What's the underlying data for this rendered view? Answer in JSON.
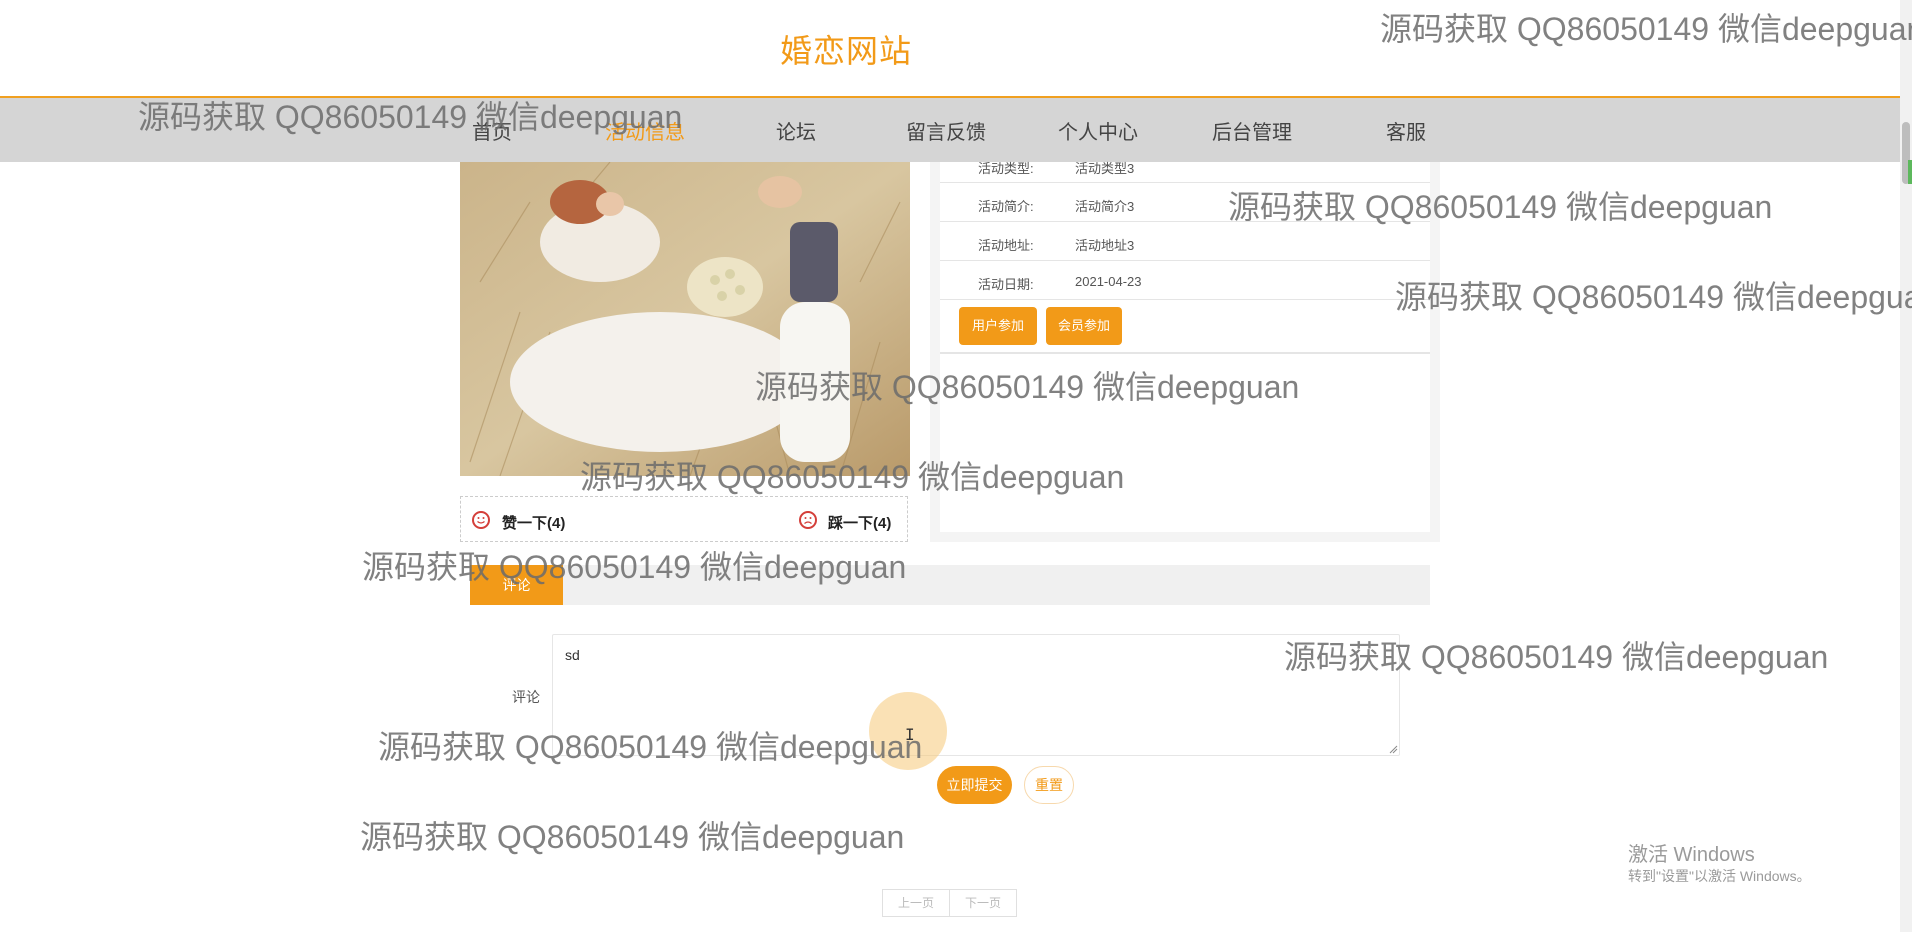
{
  "site": {
    "title": "婚恋网站"
  },
  "nav": {
    "items": [
      {
        "label": "首页"
      },
      {
        "label": "活动信息"
      },
      {
        "label": "论坛"
      },
      {
        "label": "留言反馈"
      },
      {
        "label": "个人中心"
      },
      {
        "label": "后台管理"
      },
      {
        "label": "客服"
      }
    ],
    "active_index": 1
  },
  "activity": {
    "rows": [
      {
        "label": "活动类型:",
        "value": "活动类型3"
      },
      {
        "label": "活动简介:",
        "value": "活动简介3"
      },
      {
        "label": "活动地址:",
        "value": "活动地址3"
      },
      {
        "label": "活动日期:",
        "value": "2021-04-23"
      }
    ],
    "user_join_label": "用户参加",
    "member_join_label": "会员参加"
  },
  "votes": {
    "like_label": "赞一下(4)",
    "dislike_label": "踩一下(4)"
  },
  "comment_tab": {
    "label": "评论"
  },
  "comment_form": {
    "label": "评论",
    "value": "sd",
    "submit_label": "立即提交",
    "reset_label": "重置"
  },
  "pagination": {
    "prev_label": "上一页",
    "next_label": "下一页"
  },
  "windows_activation": {
    "title": "激活 Windows",
    "subtitle": "转到\"设置\"以激活 Windows。"
  },
  "watermark": {
    "text": "源码获取 QQ86050149 微信deepguan"
  },
  "colors": {
    "accent": "#f29a18",
    "nav_bg": "#d5d5d5",
    "text": "#333333"
  },
  "icons": {
    "like": "smile-icon",
    "dislike": "frown-icon",
    "cursor": "text-cursor-icon"
  }
}
